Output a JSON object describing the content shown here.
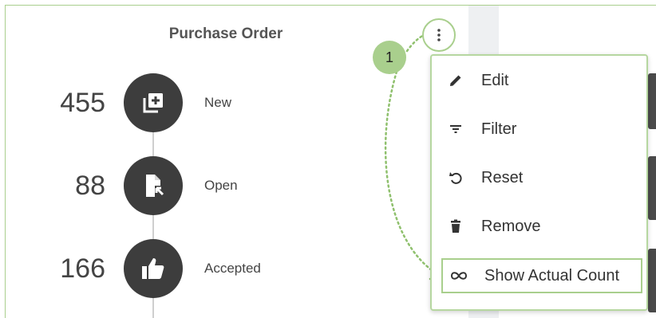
{
  "widget": {
    "title": "Purchase Order",
    "callout_number": "1"
  },
  "statuses": [
    {
      "count": "455",
      "label": "New",
      "icon": "add-copy-icon"
    },
    {
      "count": "88",
      "label": "Open",
      "icon": "document-arrow-icon"
    },
    {
      "count": "166",
      "label": "Accepted",
      "icon": "thumbs-up-icon"
    }
  ],
  "menu": {
    "items": [
      {
        "label": "Edit",
        "icon": "pencil-icon"
      },
      {
        "label": "Filter",
        "icon": "filter-icon"
      },
      {
        "label": "Reset",
        "icon": "reset-icon"
      },
      {
        "label": "Remove",
        "icon": "trash-icon"
      },
      {
        "label": "Show Actual Count",
        "icon": "infinity-icon"
      }
    ]
  },
  "colors": {
    "accent_green": "#a9cf8d",
    "icon_circle": "#3d3d3d"
  }
}
